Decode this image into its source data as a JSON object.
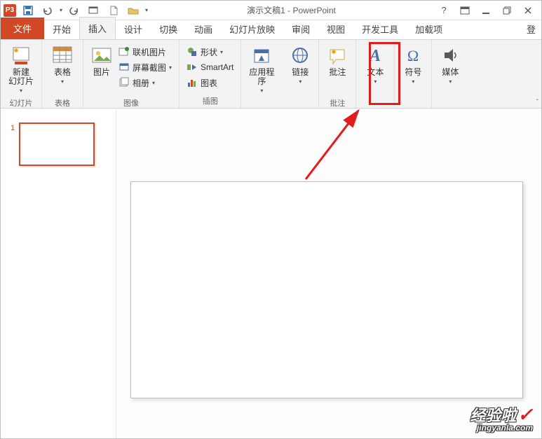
{
  "title": "演示文稿1 - PowerPoint",
  "appIconText": "P3",
  "help": "?",
  "tabs": {
    "file": "文件",
    "home": "开始",
    "insert": "插入",
    "design": "设计",
    "transition": "切换",
    "animation": "动画",
    "slideshow": "幻灯片放映",
    "review": "审阅",
    "view": "视图",
    "developer": "开发工具",
    "addins": "加载项",
    "login": "登"
  },
  "ribbon": {
    "slidesGroup": "幻灯片",
    "newSlide": "新建\n幻灯片",
    "tablesGroup": "表格",
    "table": "表格",
    "imagesGroup": "图像",
    "picture": "图片",
    "onlinePic": "联机图片",
    "screenshot": "屏幕截图",
    "album": "相册",
    "illustGroup": "插图",
    "shapes": "形状",
    "smartart": "SmartArt",
    "chart": "图表",
    "appsLabel": "应用程\n序",
    "links": "链接",
    "commentGroup": "批注",
    "comment": "批注",
    "text": "文本",
    "symbol": "符号",
    "media": "媒体"
  },
  "thumbs": {
    "num1": "1"
  },
  "watermark": {
    "main": "经验啦",
    "sub": "jingyanla.com"
  }
}
